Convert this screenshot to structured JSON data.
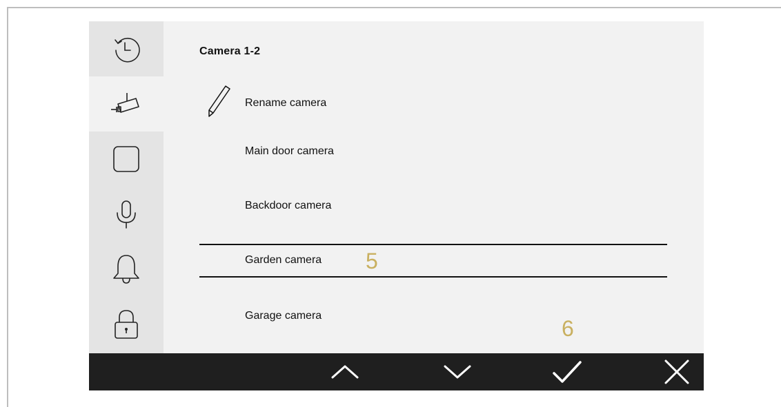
{
  "sidebar": {
    "items": [
      {
        "icon": "history-icon",
        "active": false
      },
      {
        "icon": "camera-icon",
        "active": true
      },
      {
        "icon": "square-icon",
        "active": false
      },
      {
        "icon": "microphone-icon",
        "active": false
      },
      {
        "icon": "bell-icon",
        "active": false
      },
      {
        "icon": "lock-icon",
        "active": false
      }
    ]
  },
  "main": {
    "title": "Camera 1-2",
    "rename_label": "Rename camera",
    "cameras": [
      "Main door camera",
      "Backdoor camera",
      "Garden camera",
      "Garage camera"
    ],
    "selected_index": 2
  },
  "callouts": {
    "five": "5",
    "six": "6"
  },
  "bottom_bar": {
    "buttons": [
      "chevron-up-icon",
      "chevron-down-icon",
      "checkmark-icon",
      "close-icon"
    ]
  },
  "colors": {
    "callout": "#c9b060",
    "bottom_bar": "#1f1f1f",
    "sidebar": "#e4e4e4",
    "screen": "#f2f2f2"
  }
}
